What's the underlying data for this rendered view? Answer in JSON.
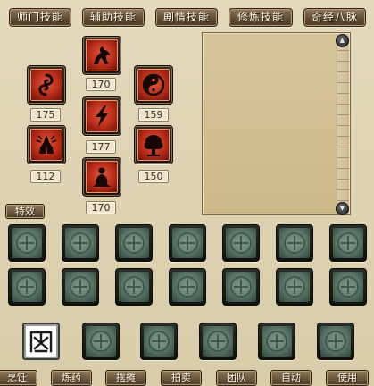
{
  "tabs": [
    "师门技能",
    "辅助技能",
    "剧情技能",
    "修炼技能",
    "奇经八脉"
  ],
  "skills": [
    {
      "icon": "rearing-beast-icon",
      "level": "170"
    },
    {
      "icon": "swirl-icon",
      "level": "175"
    },
    {
      "icon": "yin-yang-icon",
      "level": "159"
    },
    {
      "icon": "lightning-icon",
      "level": "177"
    },
    {
      "icon": "praying-hands-icon",
      "level": "112"
    },
    {
      "icon": "tree-icon",
      "level": "150"
    },
    {
      "icon": "meditating-figure-icon",
      "level": "170"
    }
  ],
  "effect_button": "特效",
  "bottom_buttons": [
    "烹饪",
    "炼药",
    "摆摊",
    "拍卖",
    "团队",
    "自动",
    "使用"
  ],
  "colors": {
    "skill_red": "#b32a18",
    "slot_jade": "#6a8576",
    "button_brown": "#5f4b33"
  }
}
